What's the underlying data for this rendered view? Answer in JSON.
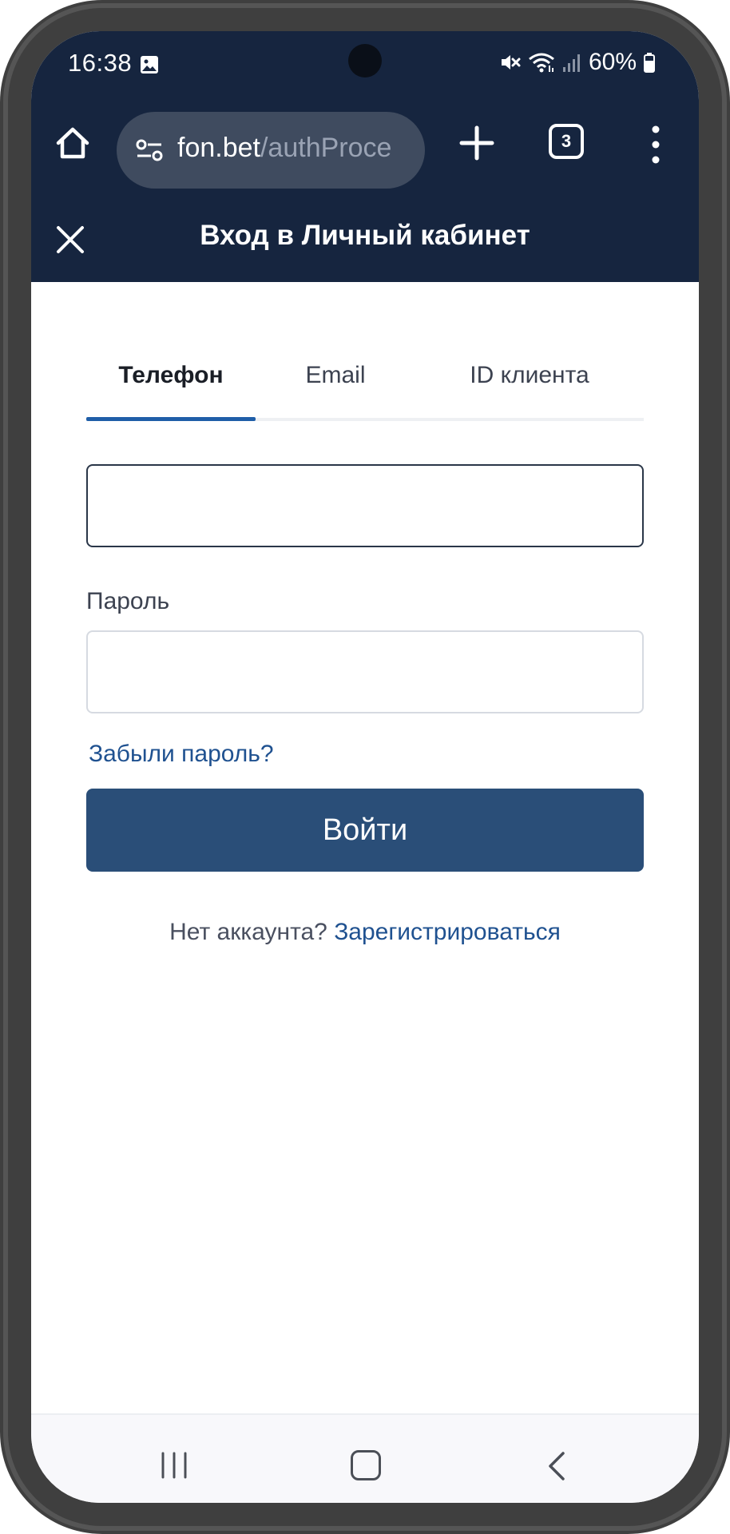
{
  "status_bar": {
    "time": "16:38",
    "battery": "60%",
    "icons": [
      "gallery-icon",
      "mute-icon",
      "wifi-icon",
      "signal-icon",
      "battery-icon"
    ]
  },
  "browser": {
    "url_domain": "fon.bet",
    "url_path": "/authProce",
    "tab_count": "3"
  },
  "header": {
    "title": "Вход в Личный кабинет"
  },
  "tabs": [
    {
      "label": "Телефон",
      "active": true
    },
    {
      "label": "Email",
      "active": false
    },
    {
      "label": "ID клиента",
      "active": false
    }
  ],
  "form": {
    "phone_value": "",
    "password_label": "Пароль",
    "password_value": "",
    "forgot_label": "Забыли пароль?",
    "submit_label": "Войти",
    "no_account_text": "Нет аккаунта?",
    "register_label": "Зарегистрироваться"
  },
  "colors": {
    "header_bg": "#16253f",
    "accent_blue": "#1f5ea8",
    "button_bg": "#2a4e78",
    "link": "#1f5190"
  }
}
